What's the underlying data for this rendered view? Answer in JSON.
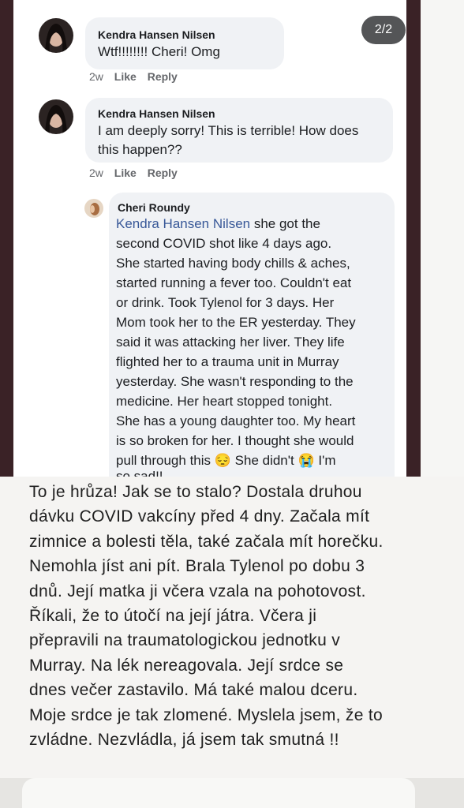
{
  "counter": "2/2",
  "comments": [
    {
      "author": "Kendra Hansen Nilsen",
      "text": "Wtf!!!!!!!! Cheri! Omg",
      "time": "2w",
      "like": "Like",
      "reply": "Reply"
    },
    {
      "author": "Kendra Hansen Nilsen",
      "line1": "I am deeply sorry! This is terrible! How does",
      "line2": "this happen??",
      "time": "2w",
      "like": "Like",
      "reply": "Reply"
    },
    {
      "author": "Cheri Roundy",
      "mention": "Kendra Hansen Nilsen",
      "first_line_rest": " she got the",
      "lines": [
        "second COVID shot like 4 days ago.",
        "She started having body chills & aches,",
        "started running a fever too. Couldn't eat",
        "or drink. Took Tylenol for 3 days. Her",
        "Mom took her to the ER yesterday. They",
        "said it was attacking her liver. They life",
        "flighted her to a trauma unit in Murray",
        "yesterday. She wasn't responding to the",
        "medicine. Her heart stopped tonight.",
        "She has a young daughter too. My heart",
        "is so broken for her. I thought she would"
      ],
      "last_a": "pull through this ",
      "emoji1": "😔",
      "last_b": " She didn't ",
      "emoji2": "😭",
      "last_c": " I'm",
      "final": "so sad!!"
    }
  ],
  "translation": {
    "lines": [
      "To je hrůza!  Jak se to stalo?  Dostala druhou",
      "dávku COVID vakcíny před 4 dny.  Začala mít",
      "zimnice a bolesti těla, také začala mít horečku.",
      "Nemohla jíst ani pít.  Brala Tylenol po dobu 3",
      "dnů.  Její matka ji včera vzala na pohotovost.",
      "Říkali, že to útočí na její játra.  Včera ji",
      "přepravili na traumatologickou jednotku v",
      "Murray.  Na lék nereagovala.  Její srdce se",
      "dnes večer zastavilo.  Má také malou dceru.",
      "Moje srdce je tak zlomené.  Myslela jsem, že to",
      "zvládne. Nezvládla, já jsem tak smutná !!"
    ]
  }
}
